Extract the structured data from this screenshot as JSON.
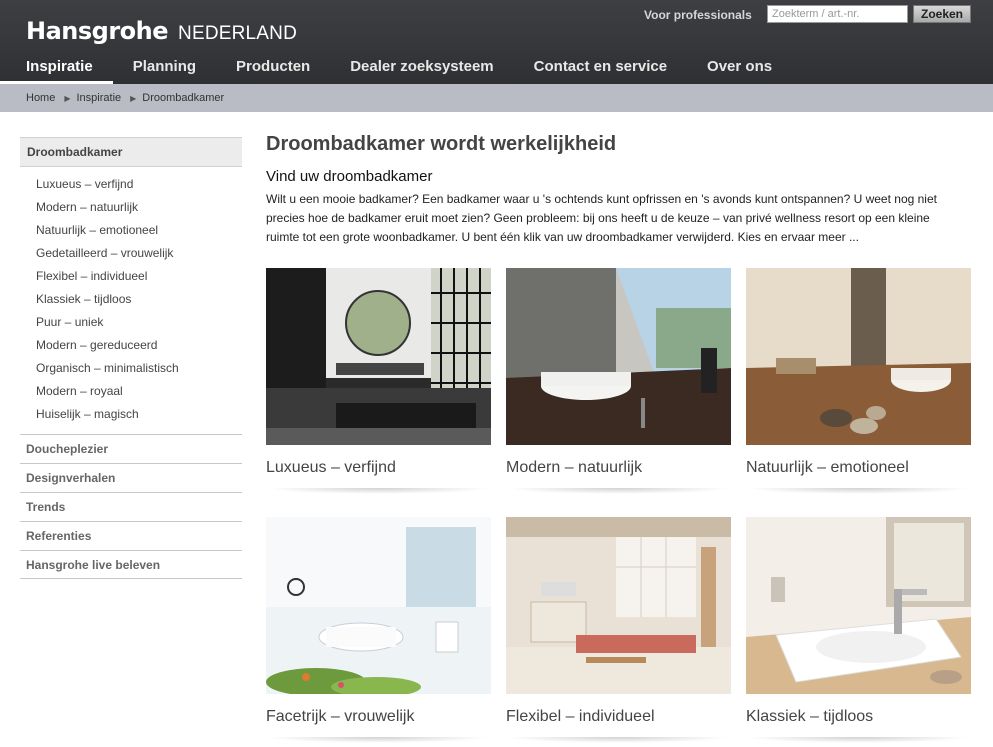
{
  "header": {
    "brand": "Hansgrohe",
    "country": "NEDERLAND",
    "pro_link": "Voor professionals",
    "search_placeholder": "Zoekterm / art.-nr.",
    "search_button": "Zoeken"
  },
  "nav": {
    "items": [
      {
        "label": "Inspiratie",
        "active": true
      },
      {
        "label": "Planning"
      },
      {
        "label": "Producten"
      },
      {
        "label": "Dealer zoeksysteem"
      },
      {
        "label": "Contact en service"
      },
      {
        "label": "Over ons"
      }
    ]
  },
  "breadcrumb": [
    "Home",
    "Inspiratie",
    "Droombadkamer"
  ],
  "sidebar": {
    "active_section": "Droombadkamer",
    "sub_items": [
      "Luxueus – verfijnd",
      "Modern – natuurlijk",
      "Natuurlijk – emotioneel",
      "Gedetailleerd – vrouwelijk",
      "Flexibel – individueel",
      "Klassiek – tijdloos",
      "Puur – uniek",
      "Modern – gereduceerd",
      "Organisch – minimalistisch",
      "Modern – royaal",
      "Huiselijk – magisch"
    ],
    "sections": [
      "Doucheplezier",
      "Designverhalen",
      "Trends",
      "Referenties",
      "Hansgrohe live beleven"
    ]
  },
  "main": {
    "title": "Droombadkamer wordt werkelijkheid",
    "subtitle": "Vind uw droombadkamer",
    "intro": "Wilt u een mooie badkamer? Een badkamer waar u 's ochtends kunt opfrissen en 's avonds kunt ontspannen? U weet nog niet precies hoe de badkamer eruit moet zien? Geen probleem: bij ons heeft u de keuze – van privé wellness resort op een kleine ruimte tot een grote woonbadkamer. U bent één klik van uw droombadkamer verwijderd. Kies en ervaar meer ...",
    "tiles": [
      {
        "label": "Luxueus – verfijnd"
      },
      {
        "label": "Modern – natuurlijk"
      },
      {
        "label": "Natuurlijk – emotioneel"
      },
      {
        "label": "Facetrijk – vrouwelijk"
      },
      {
        "label": "Flexibel – individueel"
      },
      {
        "label": "Klassiek – tijdloos"
      }
    ]
  },
  "colors": {
    "header_bg": "#37383b",
    "breadcrumb_bg": "#b9bcc4",
    "sidebar_active_bg": "#ececec"
  }
}
